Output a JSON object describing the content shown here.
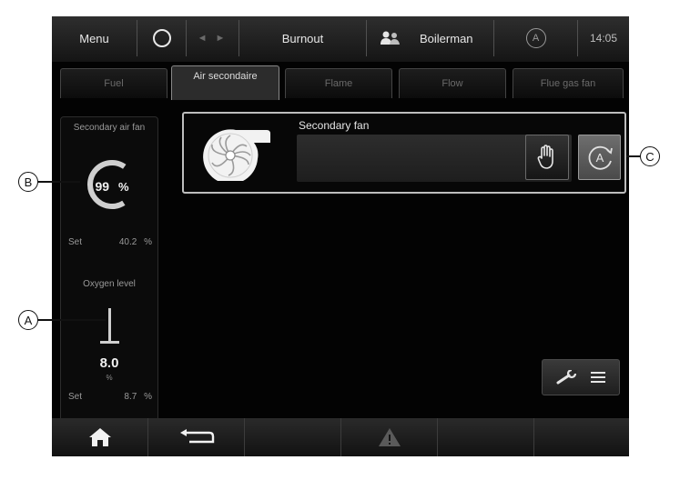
{
  "topbar": {
    "menu_label": "Menu",
    "title": "Burnout",
    "user": "Boilerman",
    "auto_symbol": "A",
    "time": "14:05"
  },
  "tabs": [
    {
      "label": "Fuel",
      "active": false
    },
    {
      "label": "Air secondaire",
      "active": true
    },
    {
      "label": "Flame",
      "active": false
    },
    {
      "label": "Flow",
      "active": false
    },
    {
      "label": "Flue gas fan",
      "active": false
    }
  ],
  "left_panel": {
    "fan_title": "Secondary air fan",
    "fan_value": "99",
    "fan_unit": "%",
    "fan_level": 0.99,
    "fan_set_label": "Set",
    "fan_set_value": "40.2",
    "fan_set_unit": "%",
    "oxygen_title": "Oxygen level",
    "oxygen_value": "8.0",
    "oxygen_unit": "%",
    "oxygen_set_label": "Set",
    "oxygen_set_value": "8.7",
    "oxygen_set_unit": "%"
  },
  "fan_card": {
    "title": "Secondary fan",
    "manual_icon": "hand-icon",
    "auto_icon": "auto-mode-icon",
    "auto_symbol": "A"
  },
  "callouts": {
    "a": "A",
    "b": "B",
    "c": "C"
  },
  "colors": {
    "background": "#030303",
    "text": "#e6e6e6",
    "muted": "#9a9a9a"
  }
}
